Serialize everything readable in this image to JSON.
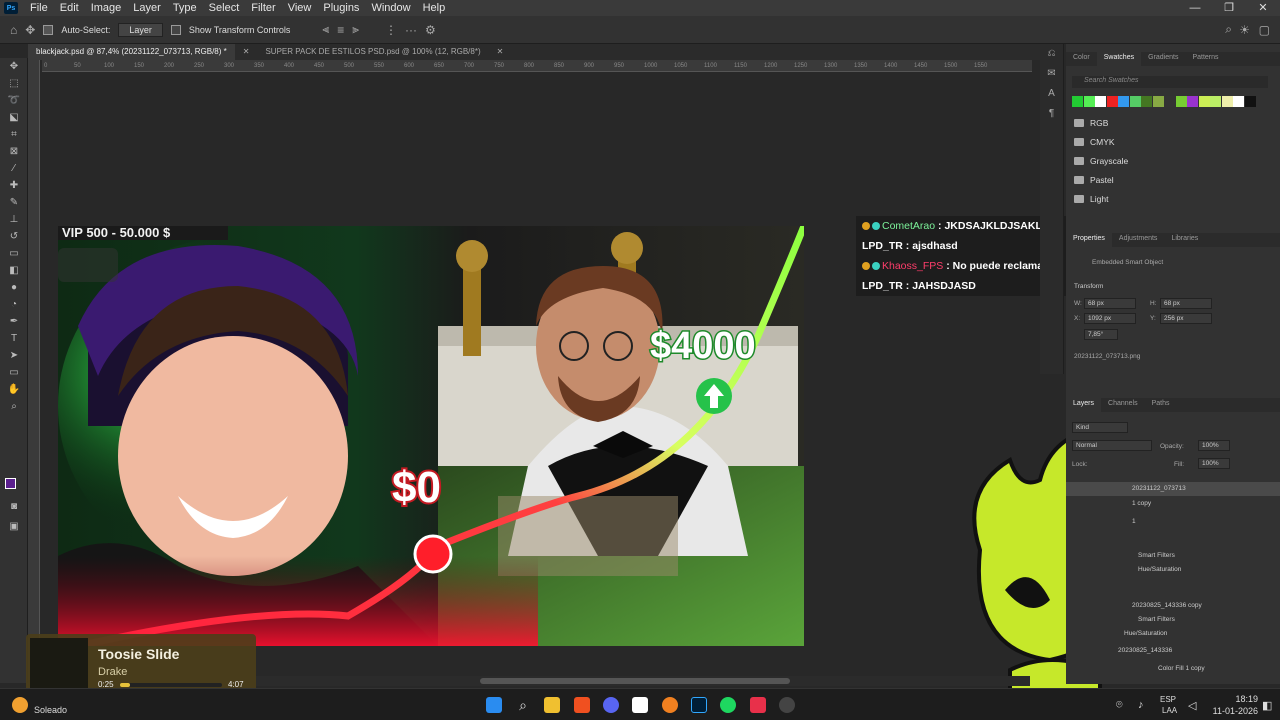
{
  "menubar": {
    "items": [
      "File",
      "Edit",
      "Image",
      "Layer",
      "Type",
      "Select",
      "Filter",
      "View",
      "Plugins",
      "Window",
      "Help"
    ],
    "logo": "Ps"
  },
  "optbar": {
    "auto_select": "Auto-Select:",
    "layer_select": "Layer",
    "show_transform": "Show Transform Controls"
  },
  "tabs": [
    {
      "label": "blackjack.psd @ 87,4% (20231122_073713, RGB/8) *",
      "active": true
    },
    {
      "label": "SUPER PACK DE ESTILOS PSD.psd @ 100% (12, RGB/8*)",
      "active": false
    }
  ],
  "chat": [
    {
      "user": "CometArao",
      "sep": ":",
      "msg": "JKDSAJKLDJSAKL",
      "user_color": "#7cf29a",
      "badges": true
    },
    {
      "user": "LPD_TR",
      "sep": ":",
      "msg": "ajsdhasd",
      "user_color": "#ffffff",
      "badges": false
    },
    {
      "user": "Khaoss_FPS",
      "sep": ":",
      "msg": "No puede reclamar",
      "user_color": "#ff3d6b",
      "badges": true
    },
    {
      "user": "LPD_TR",
      "sep": ":",
      "msg": "JAHSDJASD",
      "user_color": "#ffffff",
      "badges": false
    }
  ],
  "thumbnail": {
    "banner": "VIP 500 - 50.000 $",
    "price_high": "$4000",
    "price_low": "$0"
  },
  "right_panel": {
    "color_tabs": [
      "Color",
      "Swatches",
      "Gradients",
      "Patterns"
    ],
    "active_color_tab": "Swatches",
    "search_placeholder": "Search Swatches",
    "swatch_colors": [
      "#22cc33",
      "#55ee55",
      "#ffffff",
      "#ee2222",
      "#3399ee",
      "#55cc66",
      "#447722",
      "#88aa44",
      "#333333",
      "#77cc33",
      "#9933cc",
      "#ccee55",
      "#bbee66",
      "#eeeeaa",
      "#ffffff",
      "#111111"
    ],
    "folders": [
      "RGB",
      "CMYK",
      "Grayscale",
      "Pastel",
      "Light"
    ],
    "prop_tabs": [
      "Properties",
      "Adjustments",
      "Libraries"
    ],
    "smart_object": "Embedded Smart Object",
    "transform": "Transform",
    "w": "W:",
    "w_val": "68 px",
    "h": "H:",
    "h_val": "68 px",
    "x": "X:",
    "x_val": "1092 px",
    "y": "Y:",
    "y_val": "256 px",
    "angle": "7,85°",
    "filename": "20231122_073713.png",
    "layer_tabs": [
      "Layers",
      "Channels",
      "Paths"
    ],
    "kind": "Kind",
    "blend": "Normal",
    "opacity_label": "Opacity:",
    "opacity_val": "100%",
    "lock_label": "Lock:",
    "fill_label": "Fill:",
    "fill_val": "100%",
    "layers": [
      "20231122_073713",
      "1 copy",
      "1",
      "Smart Filters",
      "Hue/Saturation",
      "20230825_143336 copy",
      "Smart Filters",
      "Hue/Saturation",
      "20230825_143336",
      "Color Fill 1 copy"
    ]
  },
  "music": {
    "title": "Toosie Slide",
    "artist": "Drake",
    "elapsed": "0:25",
    "duration": "4:07",
    "progress": 0.1
  },
  "taskbar": {
    "weather": "Soleado",
    "lang": "ESP",
    "lang2": "LAA",
    "time": "18:19",
    "date": "11-01-2026"
  },
  "ruler_ticks": [
    "0",
    "50",
    "100",
    "150",
    "200",
    "250",
    "300",
    "350",
    "400",
    "450",
    "500",
    "550",
    "600",
    "650",
    "700",
    "750",
    "800",
    "850",
    "900",
    "950",
    "1000",
    "1050",
    "1100",
    "1150",
    "1200",
    "1250",
    "1300",
    "1350",
    "1400",
    "1450",
    "1500",
    "1550"
  ]
}
